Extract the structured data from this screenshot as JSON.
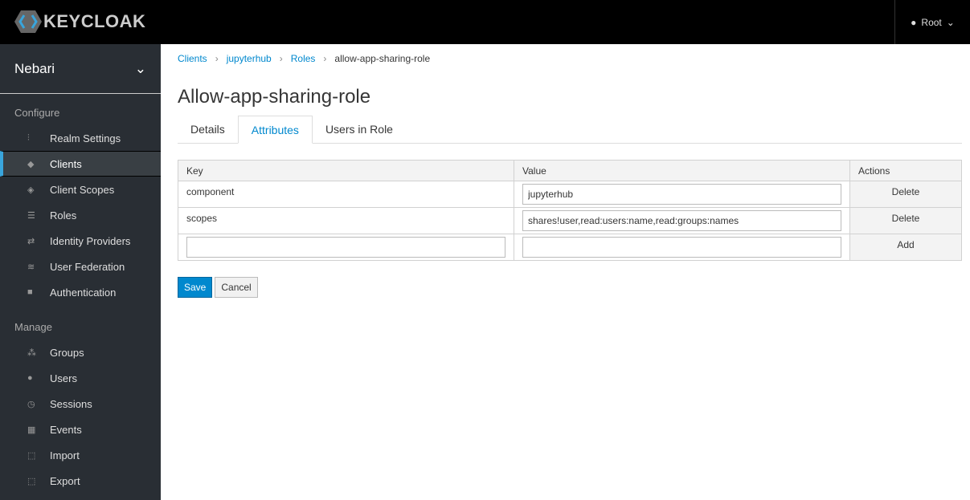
{
  "header": {
    "brand": "KEYCLOAK",
    "user": "Root"
  },
  "sidebar": {
    "realm": "Nebari",
    "configure_label": "Configure",
    "configure": [
      {
        "label": "Realm Settings",
        "icon": "sliders-icon"
      },
      {
        "label": "Clients",
        "icon": "cube-icon",
        "active": true
      },
      {
        "label": "Client Scopes",
        "icon": "cubes-icon"
      },
      {
        "label": "Roles",
        "icon": "list-icon"
      },
      {
        "label": "Identity Providers",
        "icon": "exchange-icon"
      },
      {
        "label": "User Federation",
        "icon": "database-icon"
      },
      {
        "label": "Authentication",
        "icon": "lock-icon"
      }
    ],
    "manage_label": "Manage",
    "manage": [
      {
        "label": "Groups",
        "icon": "users-icon"
      },
      {
        "label": "Users",
        "icon": "user-icon"
      },
      {
        "label": "Sessions",
        "icon": "clock-icon"
      },
      {
        "label": "Events",
        "icon": "calendar-icon"
      },
      {
        "label": "Import",
        "icon": "import-icon"
      },
      {
        "label": "Export",
        "icon": "export-icon"
      }
    ]
  },
  "breadcrumb": [
    "Clients",
    "jupyterhub",
    "Roles",
    "allow-app-sharing-role"
  ],
  "title": "Allow-app-sharing-role",
  "tabs": [
    "Details",
    "Attributes",
    "Users in Role"
  ],
  "table": {
    "headers": [
      "Key",
      "Value",
      "Actions"
    ],
    "rows": [
      {
        "key": "component",
        "value": "jupyterhub",
        "action": "Delete"
      },
      {
        "key": "scopes",
        "value": "shares!user,read:users:name,read:groups:names",
        "action": "Delete"
      }
    ],
    "new_action": "Add"
  },
  "buttons": {
    "save": "Save",
    "cancel": "Cancel"
  }
}
